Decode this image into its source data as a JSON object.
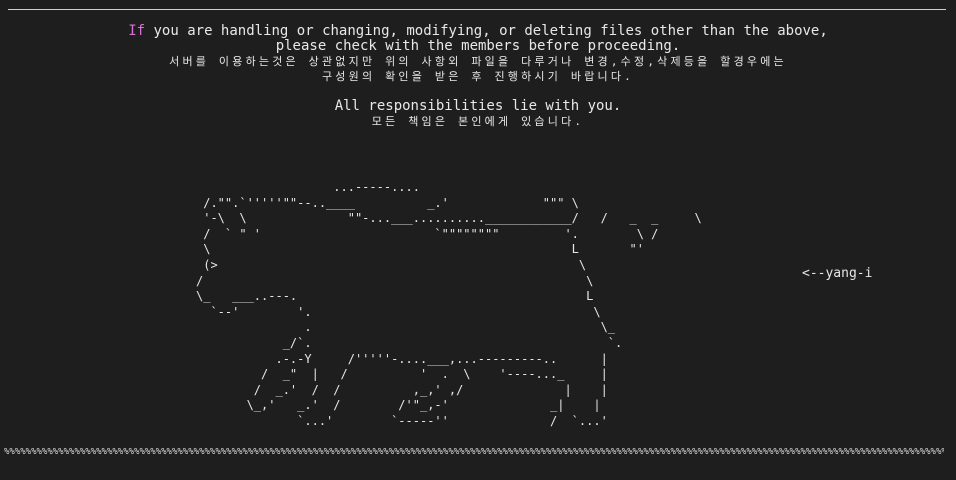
{
  "notice": {
    "line1_first_word": "If",
    "line1_rest": " you are handling or changing, modifying, or deleting files other than the above,",
    "line2": "please check with the members before proceeding.",
    "ko_line1": "서버를 이용하는것은 상관없지만 위의 사항외 파일을 다루거나 변경,수정,삭제등을 할경우에는",
    "ko_line2": "구성원의 확인을 받은 후 진행하시기 바랍니다.",
    "line3": "All responsibilities lie with you.",
    "ko_line3": "모든 책임은 본인에게 있습니다."
  },
  "signature": "<--yang-i",
  "colors": {
    "background": "#1e1e1e",
    "text": "#e8e8e8",
    "accent": "#d773d7"
  },
  "ascii_art": [
    "                   ...-----....",
    " /.\"\".`'''''\"\"--..____          _.'             \"\"\" \\",
    " '-\\  \\              \"\"-...___..........____________/   /   _  _     \\",
    " /  ` \" '                        `\"\"\"\"\"\"\"\"         '.        \\ /",
    " \\                                                  L       \"'",
    " (>                                                  \\",
    "/                                                     \\",
    "\\_   ___..---.                                        L",
    "  `--'        '.                                       \\",
    "               .                                        \\_",
    "            _/`.                                         `.",
    "           .-.-Y     /'''''-....___,...---------..      |",
    "         /  _\"  |   /          '  .  \\    '----..._     |",
    "        /  _.'  /  /          ,_,' ,/              |    |",
    "       \\_,'   _.'  /        /'\"_,-'              _|    |",
    "              `...'        `-----''              /  `...'"
  ],
  "bottom_rule": "%%%%%%%%%%%%%%%%%%%%%%%%%%%%%%%%%%%%%%%%%%%%%%%%%%%%%%%%%%%%%%%%%%%%%%%%%%%%%%%%%%%%%%%%%%%%%%%%%%%%%%%%%%%%%%%%%%%%%%%%%%%%%%%%%%%%%%%%%%%%%%%%%%%%%%%%%%%%%%%%%%%%%%%%%%%%%%%%%%%%%%%%%%%%%%%%%%%%%%%%%%%%%%%%%%%%%%%%%%%%%%%%%%%%%%%%"
}
